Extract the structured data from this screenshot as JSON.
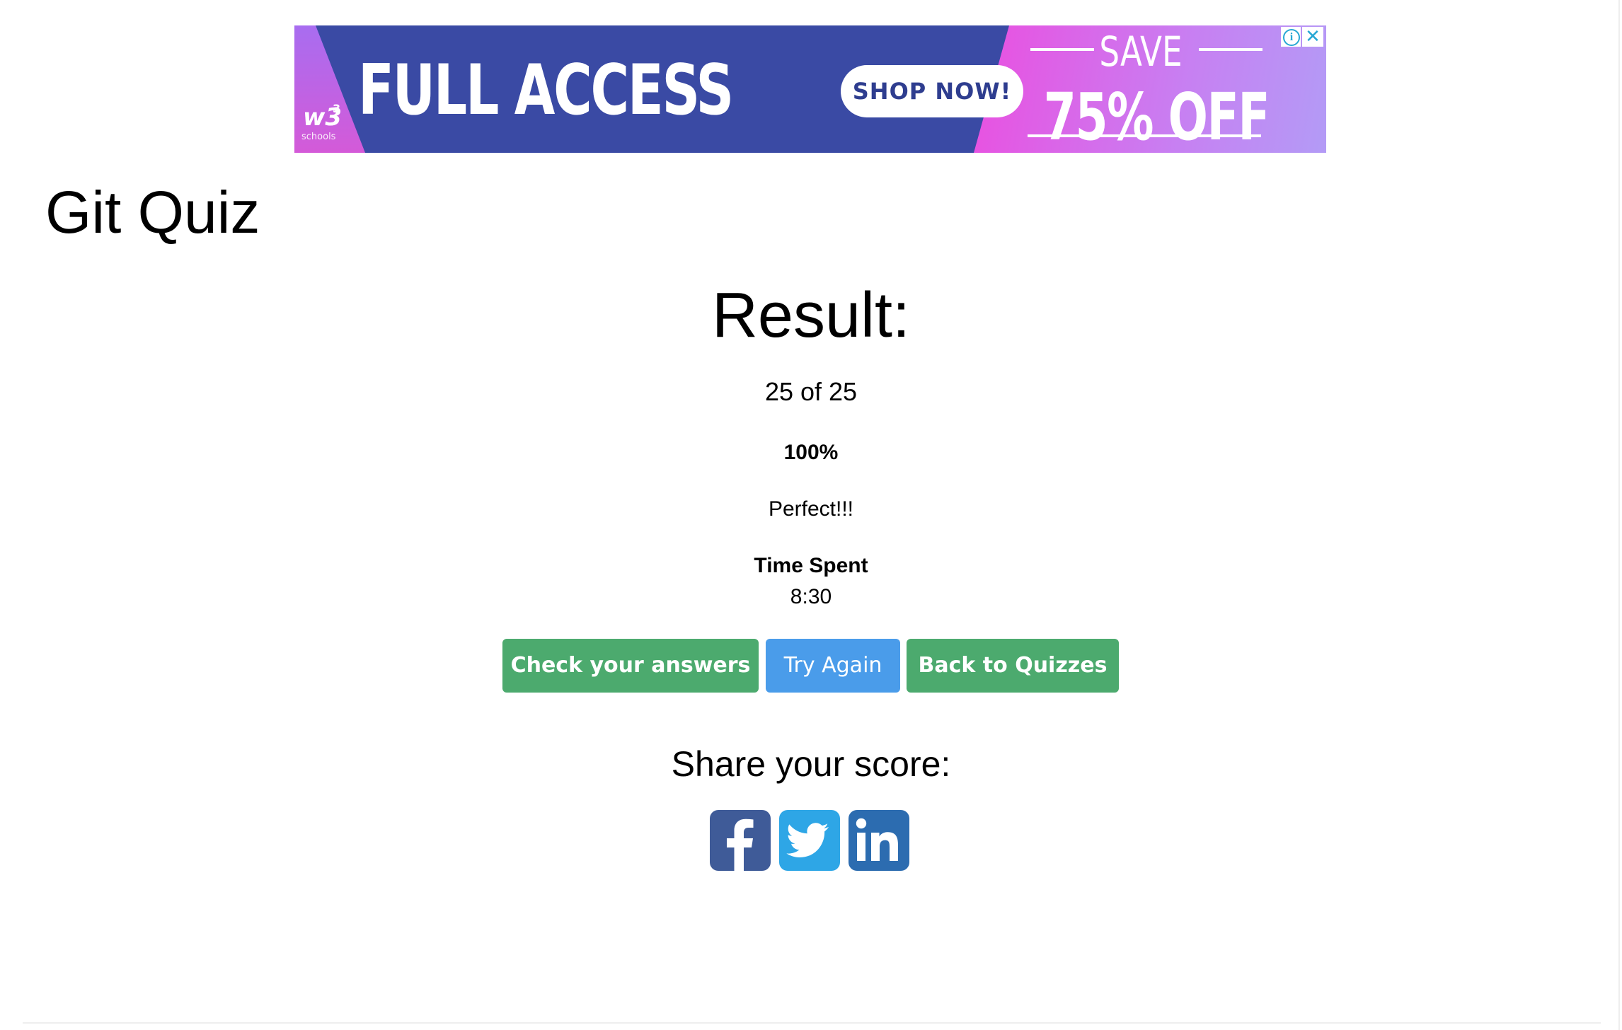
{
  "ad": {
    "brand": "w3",
    "brand_sup": "3",
    "brand_text": "schools",
    "headline": "FULL ACCESS",
    "cta_label": "SHOP NOW!",
    "save_label": "SAVE",
    "discount_label": "75% OFF",
    "info_icon": "i",
    "close_icon": "✕",
    "colors": {
      "banner_blue": "#3a4aa4",
      "gradient_pink": "#ea4fe0",
      "gradient_violet": "#b39bf6",
      "cta_text": "#2e3d8f"
    }
  },
  "page": {
    "title": "Git Quiz"
  },
  "result": {
    "heading": "Result:",
    "score": "25 of 25",
    "percent": "100%",
    "message": "Perfect!!!",
    "time_label": "Time Spent",
    "time_value": "8:30"
  },
  "actions": {
    "check_label": "Check your answers",
    "retry_label": "Try Again",
    "back_label": "Back to Quizzes",
    "colors": {
      "green": "#4caa6e",
      "blue": "#4a9cea"
    }
  },
  "share": {
    "heading": "Share your score:",
    "icons": [
      "facebook-icon",
      "twitter-icon",
      "linkedin-icon"
    ],
    "colors": {
      "facebook": "#3f5b98",
      "twitter": "#2ea6e6",
      "linkedin": "#2c6cb0"
    }
  }
}
